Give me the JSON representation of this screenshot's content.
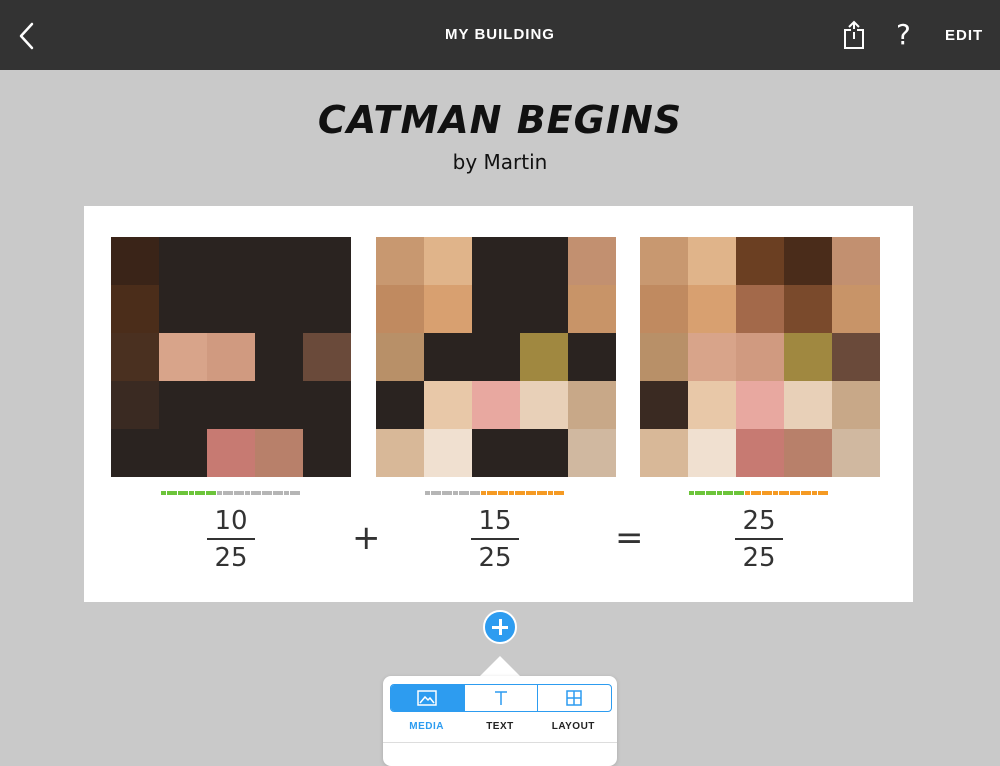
{
  "topbar": {
    "title": "MY BUILDING",
    "edit_label": "EDIT",
    "help_label": "?",
    "icons": [
      "back-chevron-icon",
      "share-icon",
      "help-icon"
    ]
  },
  "document": {
    "title": "CATMAN BEGINS",
    "author": "by Martin"
  },
  "equation": {
    "operators": [
      "+",
      "="
    ],
    "fractions": [
      {
        "numerator": "10",
        "denominator": "25",
        "progress_green": 10,
        "progress_orange": 0,
        "progress_total": 25
      },
      {
        "numerator": "15",
        "denominator": "25",
        "progress_green": 0,
        "progress_orange": 15,
        "progress_total": 25
      },
      {
        "numerator": "25",
        "denominator": "25",
        "progress_green": 10,
        "progress_orange": 15,
        "progress_total": 25
      }
    ],
    "images": [
      "boy-face-photo",
      "cat-face-photo",
      "boy-cat-composite-photo"
    ]
  },
  "insert_menu": {
    "tabs": [
      {
        "label": "MEDIA",
        "icon": "image-icon",
        "active": true
      },
      {
        "label": "TEXT",
        "icon": "text-icon",
        "active": false
      },
      {
        "label": "LAYOUT",
        "icon": "grid-layout-icon",
        "active": false
      }
    ]
  },
  "colors": {
    "topbar": "#333333",
    "accent": "#2d9cf0",
    "green": "#6cc43a",
    "orange": "#f59a23",
    "gray_bar": "#b5b5b5"
  }
}
